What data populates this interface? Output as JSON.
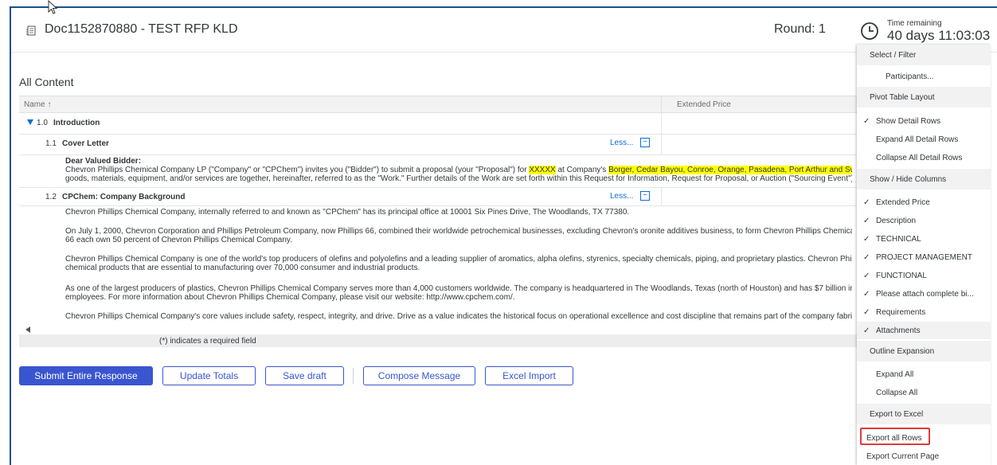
{
  "header": {
    "doc_title": "Doc1152870880 - TEST RFP KLD",
    "round": "Round: 1",
    "time_label": "Time remaining",
    "time_value": "40 days 11:03:03"
  },
  "content": {
    "section_title": "All Content",
    "columns": [
      "Name ↑",
      "Extended Price"
    ],
    "required_note": "(*) indicates a required field"
  },
  "rows": [
    {
      "num": "1.0",
      "label": "Introduction"
    },
    {
      "num": "1.1",
      "label": "Cover Letter",
      "toggle": "Less..."
    },
    {
      "num": "1.2",
      "label": "CPChem: Company Background",
      "toggle": "Less..."
    }
  ],
  "cover_letter": {
    "greeting": "Dear Valued Bidder:",
    "line1_a": "Chevron Phillips Chemical Company LP (\"Company\" or \"CPChem\") invites you (\"Bidder\") to submit a proposal (your \"Proposal\") for ",
    "line1_hl1": "XXXXX",
    "line1_b": " at Company's ",
    "line1_hl2": "Borger, Cedar Bayou, Conroe, Orange, Pasadena, Port Arthur and Sweeny/Old",
    "line2": "goods, materials, equipment, and/or services are together, hereinafter, referred to as the \"Work.\" Further details of the Work are set forth within this Request for Information, Request for Proposal, or Auction (\"Sourcing Event\")."
  },
  "background": {
    "p1": "Chevron Phillips Chemical Company, internally referred to and known as \"CPChem\" has its principal office at 10001 Six Pines Drive, The Woodlands, TX 77380.",
    "p2a": "On July 1, 2000, Chevron Corporation and Phillips Petroleum Company, now Phillips 66, combined their worldwide petrochemical businesses, excluding Chevron's oronite additives business, to form Chevron Phillips Chemical Compa",
    "p2b": "66 each own 50 percent of Chevron Phillips Chemical Company.",
    "p3a": "Chevron Phillips Chemical Company is one of the world's top producers of olefins and polyolefins and a leading supplier of aromatics, alpha olefins, styrenics, specialty chemicals, piping, and proprietary plastics. Chevron Phillips Che",
    "p3b": "chemical products that are essential to manufacturing over 70,000 consumer and industrial products.",
    "p4a": "As one of the largest producers of plastics, Chevron Phillips Chemical Company serves more than 4,000 customers worldwide. The company is headquartered in The Woodlands, Texas (north of Houston) and has $7 billion in assets a",
    "p4b": "employees. For more information about Chevron Phillips Chemical Company, please visit our website: http://www.cpchem.com/.",
    "p5": "Chevron Phillips Chemical Company's core values include safety, respect, integrity, and drive. Drive as a value indicates the historical focus on operational excellence and cost discipline that remains part of the company fabric. Chevr"
  },
  "buttons": {
    "submit": "Submit Entire Response",
    "update": "Update Totals",
    "save": "Save draft",
    "compose": "Compose Message",
    "excel": "Excel Import"
  },
  "menu": {
    "g_select": "Select / Filter",
    "participants": "Participants...",
    "g_pivot": "Pivot Table Layout",
    "show_detail": "Show Detail Rows",
    "expand_detail": "Expand All Detail Rows",
    "collapse_detail": "Collapse All Detail Rows",
    "g_columns": "Show / Hide Columns",
    "col_ext": "Extended Price",
    "col_desc": "Description",
    "col_tech": "TECHNICAL",
    "col_pm": "PROJECT MANAGEMENT",
    "col_func": "FUNCTIONAL",
    "col_attach_bi": "Please attach complete bi...",
    "col_req": "Requirements",
    "col_attach": "Attachments",
    "g_outline": "Outline Expansion",
    "expand_all": "Expand All",
    "collapse_all": "Collapse All",
    "g_export": "Export to Excel",
    "export_all": "Export all Rows",
    "export_page": "Export Current Page",
    "check": "✓"
  }
}
